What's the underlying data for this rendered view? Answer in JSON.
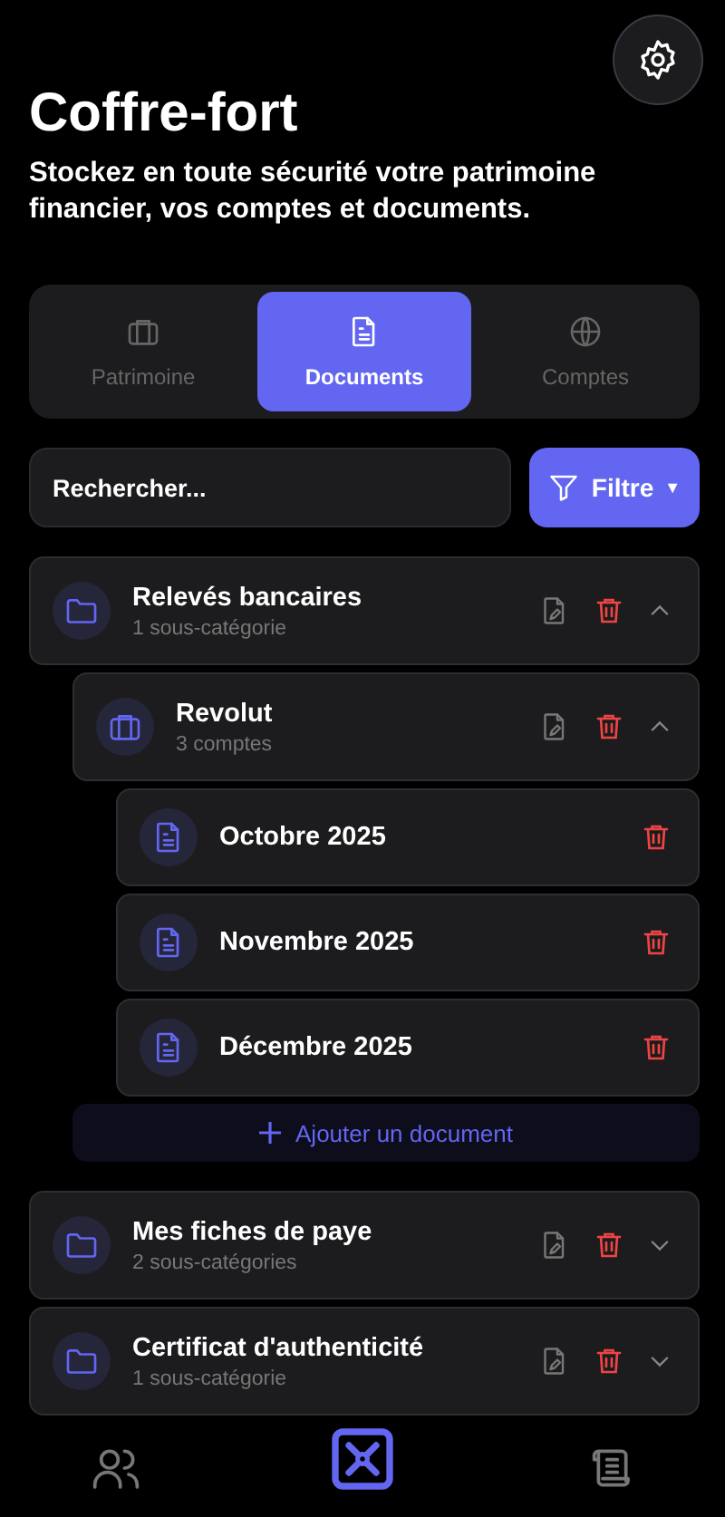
{
  "header": {
    "title": "Coffre-fort",
    "subtitle": "Stockez en toute sécurité votre patrimoine financier, vos comptes et documents."
  },
  "tabs": [
    {
      "label": "Patrimoine",
      "kind": "briefcase",
      "selected": false
    },
    {
      "label": "Documents",
      "kind": "document",
      "selected": true
    },
    {
      "label": "Comptes",
      "kind": "globe",
      "selected": false
    }
  ],
  "search": {
    "placeholder": "Rechercher..."
  },
  "filter": {
    "label": "Filtre",
    "caret": "▼"
  },
  "categories": [
    {
      "kind": "folder",
      "title": "Relevés bancaires",
      "subtitle": "1 sous-catégorie",
      "expanded": true,
      "children": [
        {
          "kind": "account",
          "title": "Revolut",
          "subtitle": "3 comptes",
          "expanded": true,
          "add_label": "Ajouter un document",
          "children": [
            {
              "kind": "document",
              "title": "Octobre 2025"
            },
            {
              "kind": "document",
              "title": "Novembre 2025"
            },
            {
              "kind": "document",
              "title": "Décembre 2025"
            }
          ]
        }
      ]
    },
    {
      "kind": "folder",
      "title": "Mes fiches de paye",
      "subtitle": "2 sous-catégories",
      "expanded": false
    },
    {
      "kind": "folder",
      "title": "Certificat d'authenticité",
      "subtitle": "1 sous-catégorie",
      "expanded": false
    }
  ],
  "nav": [
    {
      "kind": "people",
      "selected": false
    },
    {
      "kind": "safe",
      "selected": true
    },
    {
      "kind": "scroll",
      "selected": false
    }
  ]
}
